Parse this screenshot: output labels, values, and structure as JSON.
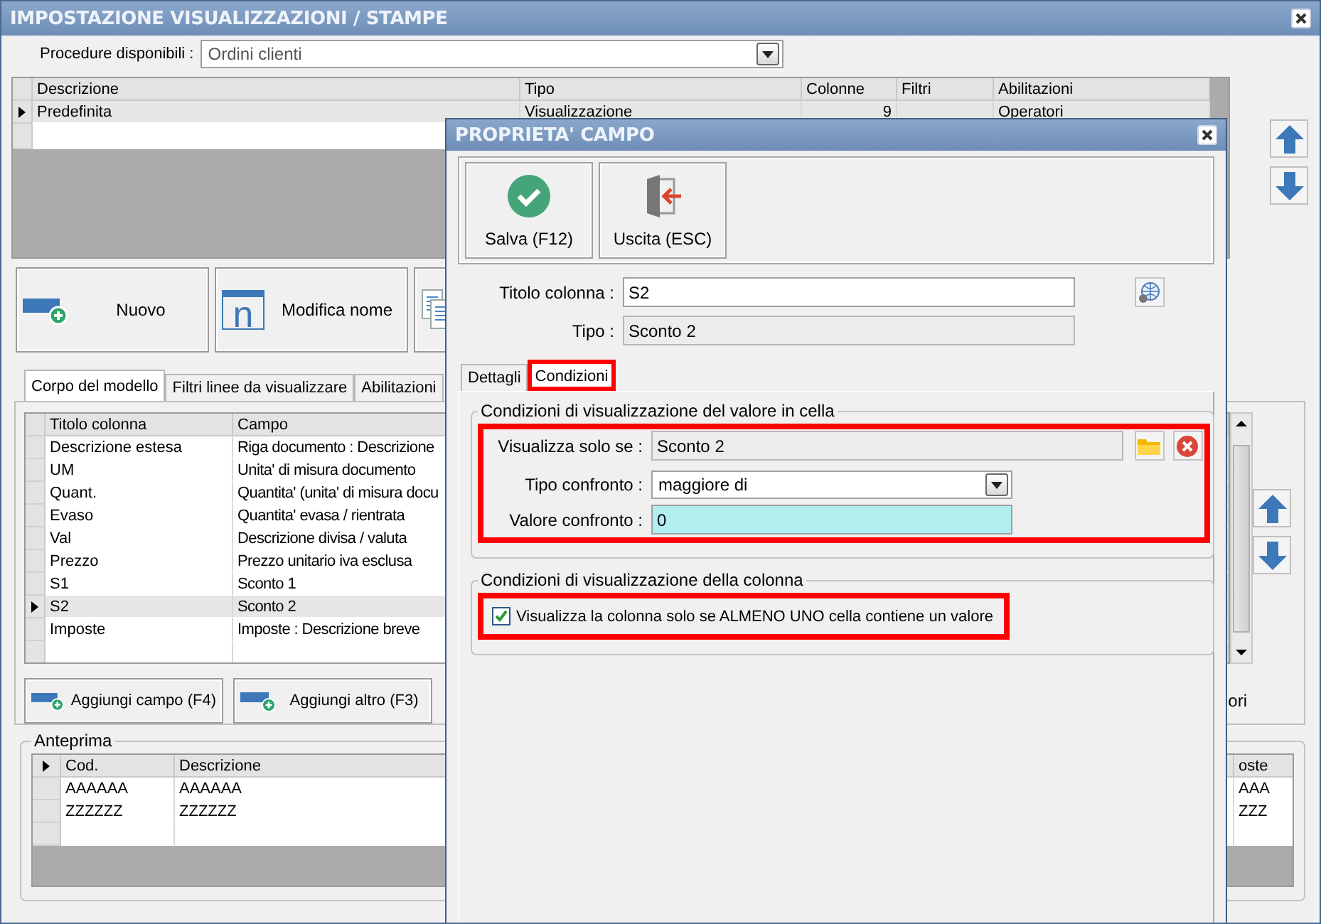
{
  "window": {
    "title": "IMPOSTAZIONE VISUALIZZAZIONI / STAMPE"
  },
  "procedure": {
    "label": "Procedure disponibili :",
    "value": "Ordini clienti"
  },
  "models_table": {
    "columns": [
      "Descrizione",
      "Tipo",
      "Colonne",
      "Filtri",
      "Abilitazioni"
    ],
    "rows": [
      {
        "descrizione": "Predefinita",
        "tipo": "Visualizzazione",
        "colonne": "9",
        "abilitazioni": "Operatori",
        "selected": true
      }
    ]
  },
  "model_buttons": [
    {
      "kind": "new",
      "label": "Nuovo"
    },
    {
      "kind": "rename",
      "label": "Modifica nome",
      "icon_text": "n"
    },
    {
      "kind": "document"
    }
  ],
  "tabs": [
    {
      "label": "Corpo del modello",
      "selected": true
    },
    {
      "label": "Filtri linee da visualizzare",
      "selected": false
    },
    {
      "label": "Abilitazioni",
      "selected": false
    }
  ],
  "columns_table": {
    "columns": [
      "Titolo colonna",
      "Campo"
    ],
    "rows": [
      {
        "title": "Descrizione estesa",
        "field": "Riga documento : Descrizione",
        "selected": false
      },
      {
        "title": "UM",
        "field": "Unita' di misura documento",
        "selected": false
      },
      {
        "title": "Quant.",
        "field": "Quantita' (unita' di misura docu",
        "selected": false
      },
      {
        "title": "Evaso",
        "field": "Quantita' evasa / rientrata",
        "selected": false
      },
      {
        "title": "Val",
        "field": "Descrizione divisa / valuta",
        "selected": false
      },
      {
        "title": "Prezzo",
        "field": "Prezzo unitario iva esclusa",
        "selected": false
      },
      {
        "title": "S1",
        "field": "Sconto 1",
        "selected": false
      },
      {
        "title": "S2",
        "field": "Sconto 2",
        "selected": true
      },
      {
        "title": "Imposte",
        "field": "Imposte : Descrizione breve",
        "selected": false
      }
    ]
  },
  "add_buttons": [
    {
      "label": "Aggiungi campo (F4)"
    },
    {
      "label": "Aggiungi altro (F3)"
    }
  ],
  "cut_label": "ori",
  "preview": {
    "title": "Anteprima",
    "columns": [
      "Cod.",
      "Descrizione",
      "oste"
    ],
    "rows": [
      [
        "AAAAAA",
        "AAAAAA",
        "AAA"
      ],
      [
        "ZZZZZZ",
        "ZZZZZZ",
        "ZZZ"
      ]
    ]
  },
  "dialog": {
    "title": "PROPRIETA' CAMPO",
    "toolbar": [
      {
        "kind": "save",
        "label": "Salva (F12)"
      },
      {
        "kind": "exit",
        "label": "Uscita (ESC)"
      }
    ],
    "column_title": {
      "label": "Titolo colonna :",
      "value": "S2"
    },
    "type": {
      "label": "Tipo :",
      "value": "Sconto 2"
    },
    "tabs": [
      {
        "label": "Dettagli",
        "selected": false,
        "highlighted": false
      },
      {
        "label": "Condizioni",
        "selected": true,
        "highlighted": true
      }
    ],
    "cell_group": {
      "title": "Condizioni di visualizzazione del valore in cella",
      "highlighted": true,
      "show_if": {
        "label": "Visualizza solo se :",
        "value": "Sconto 2"
      },
      "compare_type": {
        "label": "Tipo confronto :",
        "value": "maggiore di"
      },
      "compare_value": {
        "label": "Valore confronto :",
        "value": "0"
      }
    },
    "column_group": {
      "title": "Condizioni di visualizzazione della colonna",
      "highlighted": true,
      "checkbox": {
        "label": "Visualizza la colonna solo se ALMENO UNO cella contiene un valore",
        "checked": true
      }
    }
  }
}
